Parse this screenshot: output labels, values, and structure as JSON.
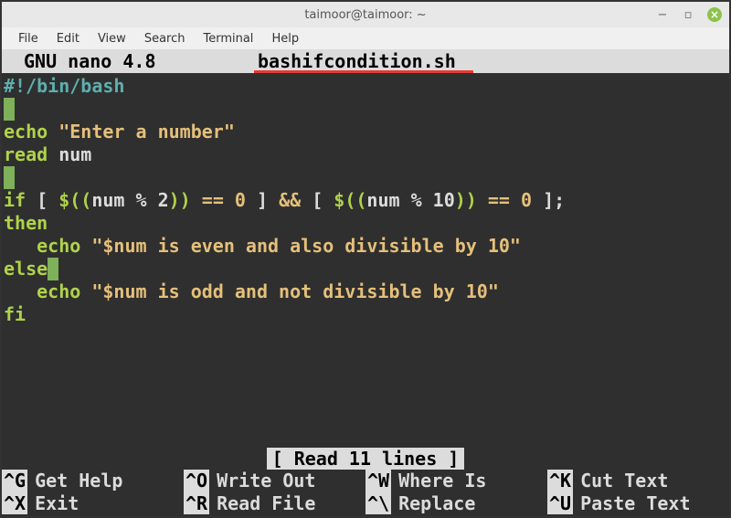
{
  "window": {
    "title": "taimoor@taimoor: ~"
  },
  "menu": {
    "file": "File",
    "edit": "Edit",
    "view": "View",
    "search": "Search",
    "terminal": "Terminal",
    "help": "Help"
  },
  "nano": {
    "app_label": "GNU nano 4.8",
    "filename": "bashifcondition.sh",
    "status": "[ Read 11 lines ]"
  },
  "code": {
    "shebang": "#!/bin/bash",
    "echo1_kw": "echo",
    "echo1_str": "\"Enter a number\"",
    "read_kw": "read",
    "read_var": "num",
    "if_line_kw1": "if",
    "if_line_body1": " [ ",
    "if_line_expr1a": "$((",
    "if_line_expr1v": "num % 2",
    "if_line_expr1b": "))",
    "if_line_eq1": " == 0",
    "if_line_body2": " ] ",
    "if_line_and": "&& ",
    "if_line_body3": "[ ",
    "if_line_expr2a": "$((",
    "if_line_expr2v": "num % 10",
    "if_line_expr2b": "))",
    "if_line_eq2": " == 0",
    "if_line_body4": " ];",
    "then_kw": "then",
    "echo2_indent": "   ",
    "echo2_kw": "echo",
    "echo2_str": "\"$num is even and also divisible by 10\"",
    "else_kw": "else",
    "echo3_indent": "   ",
    "echo3_kw": "echo",
    "echo3_str": "\"$num is odd and not divisible by 10\"",
    "fi_kw": "fi"
  },
  "shortcuts": {
    "r1": [
      {
        "key": "^G",
        "label": "Get Help"
      },
      {
        "key": "^O",
        "label": "Write Out"
      },
      {
        "key": "^W",
        "label": "Where Is"
      },
      {
        "key": "^K",
        "label": "Cut Text"
      }
    ],
    "r2": [
      {
        "key": "^X",
        "label": "Exit"
      },
      {
        "key": "^R",
        "label": "Read File"
      },
      {
        "key": "^\\",
        "label": "Replace"
      },
      {
        "key": "^U",
        "label": "Paste Text"
      }
    ]
  }
}
